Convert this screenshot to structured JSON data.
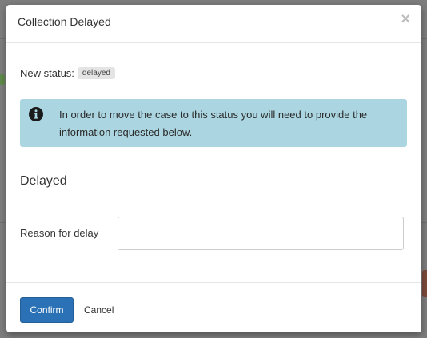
{
  "modal": {
    "title": "Collection Delayed",
    "close_glyph": "×",
    "status_label": "New status:",
    "status_badge": "delayed",
    "alert_text": "In order to move the case to this status you will need to provide the information requested below.",
    "section_heading": "Delayed",
    "field_label": "Reason for delay",
    "field_value": "",
    "confirm_label": "Confirm",
    "cancel_label": "Cancel"
  },
  "colors": {
    "alert_bg": "#abd6e1",
    "primary": "#2a72b5",
    "badge_bg": "#e4e4e4"
  },
  "icons": {
    "alert_icon": "info-circle-icon",
    "close_icon": "close-icon"
  }
}
